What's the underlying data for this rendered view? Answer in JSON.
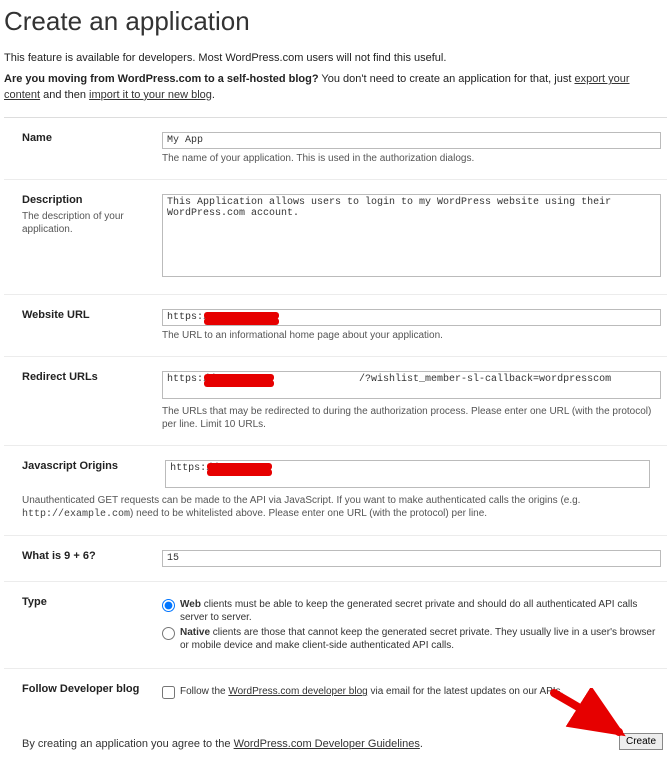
{
  "page_title": "Create an application",
  "intro_line1": "This feature is available for developers. Most WordPress.com users will not find this useful.",
  "intro_line2_q": "Are you moving from WordPress.com to a self-hosted blog?",
  "intro_line2_rest_a": " You don't need to create an application for that, just ",
  "intro_link_export": "export your content",
  "intro_line2_rest_b": " and then ",
  "intro_link_import": "import it to your new blog",
  "intro_line2_rest_c": ".",
  "fields": {
    "name": {
      "label": "Name",
      "value": "My App",
      "help": "The name of your application. This is used in the authorization dialogs."
    },
    "description": {
      "label": "Description",
      "sublabel": "The description of your application.",
      "value": "This Application allows users to login to my WordPress website using their WordPress.com account."
    },
    "website": {
      "label": "Website URL",
      "value": "https://",
      "help": "The URL to an informational home page about your application."
    },
    "redirect": {
      "label": "Redirect URLs",
      "value": "https://                        /?wishlist_member-sl-callback=wordpresscom",
      "help": "The URLs that may be redirected to during the authorization process. Please enter one URL (with the protocol) per line. Limit 10 URLs."
    },
    "jsorigins": {
      "label": "Javascript Origins",
      "value": "https://",
      "help_prefix": "Unauthenticated GET requests can be made to the API via JavaScript. If you want to make authenticated calls the origins (e.g. ",
      "help_code": "http://example.com",
      "help_suffix": ") need to be whitelisted above. Please enter one URL (with the protocol) per line."
    },
    "captcha": {
      "label": "What is 9 + 6?",
      "value": "15"
    },
    "type": {
      "label": "Type",
      "web_bold": "Web",
      "web_text": " clients must be able to keep the generated secret private and should do all authenticated API calls server to server.",
      "native_bold": "Native",
      "native_text": " clients are those that cannot keep the generated secret private. They usually live in a user's browser or mobile device and make client-side authenticated API calls."
    },
    "follow": {
      "label": "Follow Developer blog",
      "text_a": "Follow the ",
      "link": "WordPress.com developer blog",
      "text_b": " via email for the latest updates on our APIs."
    }
  },
  "footer": {
    "text_a": "By creating an application you agree to the ",
    "link": "WordPress.com Developer Guidelines",
    "text_b": ".",
    "button": "Create"
  }
}
